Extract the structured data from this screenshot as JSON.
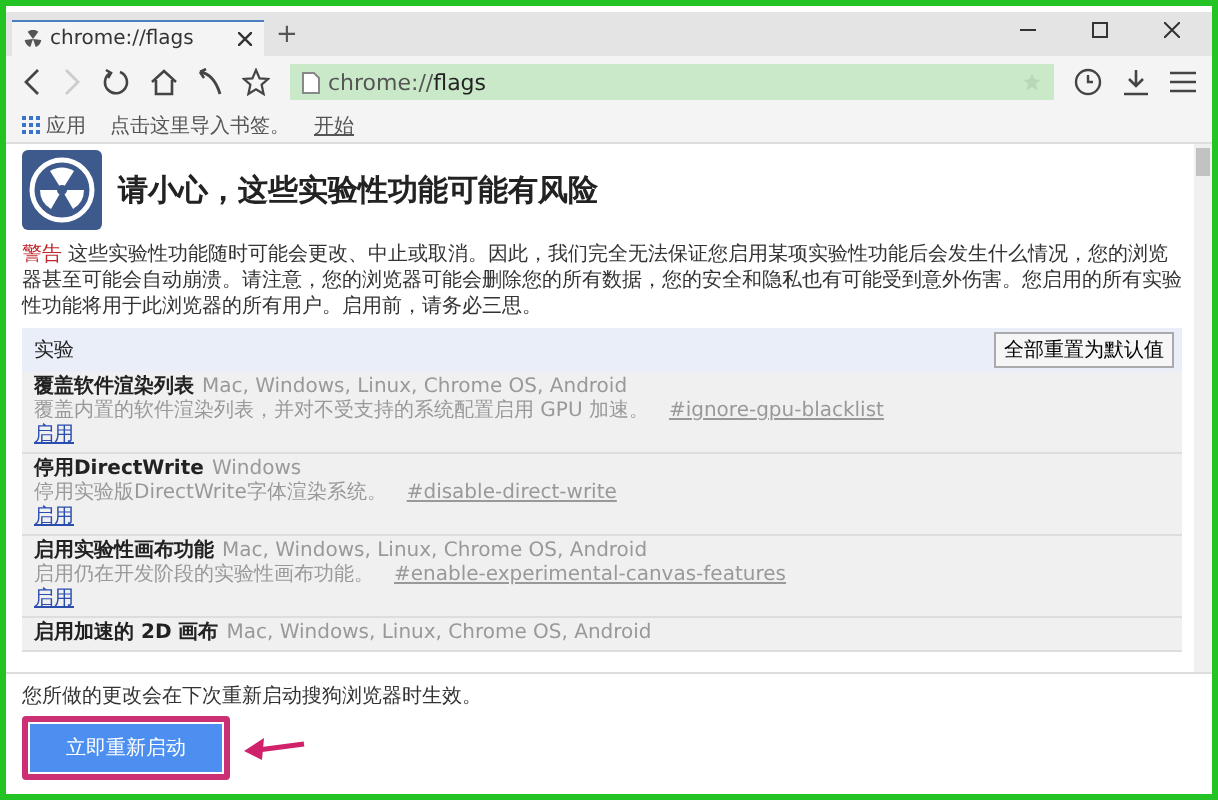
{
  "tab": {
    "title": "chrome://flags",
    "new_tab": "+"
  },
  "address": {
    "scheme": "chrome://",
    "path": "flags"
  },
  "bookmarks": [
    {
      "label": "应用",
      "kind": "apps"
    },
    {
      "label": "点击这里导入书签。",
      "kind": "text"
    },
    {
      "label": "开始",
      "kind": "link"
    }
  ],
  "header": {
    "title": "请小心，这些实验性功能可能有风险"
  },
  "warning": {
    "label": "警告",
    "text": "这些实验性功能随时可能会更改、中止或取消。因此，我们完全无法保证您启用某项实验性功能后会发生什么情况，您的浏览器甚至可能会自动崩溃。请注意，您的浏览器可能会删除您的所有数据，您的安全和隐私也有可能受到意外伤害。您启用的所有实验性功能将用于此浏览器的所有用户。启用前，请务必三思。"
  },
  "section": {
    "title": "实验",
    "reset_button": "全部重置为默认值"
  },
  "experiments": [
    {
      "name": "覆盖软件渲染列表",
      "platforms": "Mac, Windows, Linux, Chrome OS, Android",
      "description": "覆盖内置的软件渲染列表，并对不受支持的系统配置启用 GPU 加速。",
      "flag": "#ignore-gpu-blacklist",
      "action": "启用"
    },
    {
      "name": "停用DirectWrite",
      "platforms": "Windows",
      "description": "停用实验版DirectWrite字体渲染系统。",
      "flag": "#disable-direct-write",
      "action": "启用"
    },
    {
      "name": "启用实验性画布功能",
      "platforms": "Mac, Windows, Linux, Chrome OS, Android",
      "description": "启用仍在开发阶段的实验性画布功能。",
      "flag": "#enable-experimental-canvas-features",
      "action": "启用"
    },
    {
      "name": "启用加速的 2D 画布",
      "platforms": "Mac, Windows, Linux, Chrome OS, Android"
    }
  ],
  "footer": {
    "note": "您所做的更改会在下次重新启动搜狗浏览器时生效。",
    "relaunch_button": "立即重新启动"
  }
}
